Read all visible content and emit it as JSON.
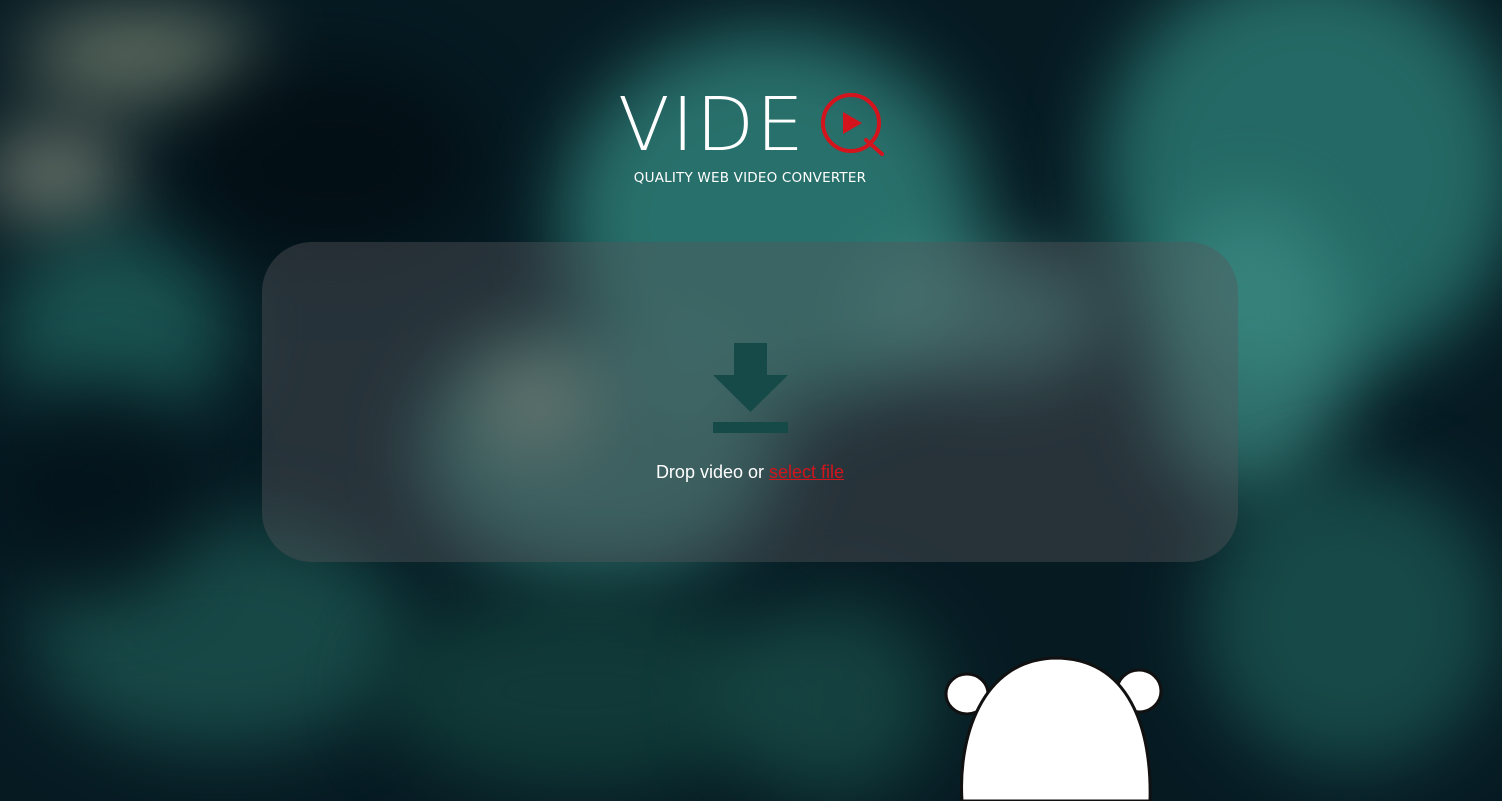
{
  "app": {
    "logo_text": "VIDE",
    "logo_letter": "Q",
    "tagline": "QUALITY WEB VIDEO CONVERTER"
  },
  "dropzone": {
    "prompt_text": "Drop video or",
    "link_label": "select file",
    "icon": "download-icon"
  },
  "colors": {
    "accent": "#d4141c",
    "icon": "#164a48",
    "text": "#ffffff",
    "panel": "rgba(86,86,90,0.42)"
  },
  "decor": {
    "mascot": "bear-mascot"
  }
}
